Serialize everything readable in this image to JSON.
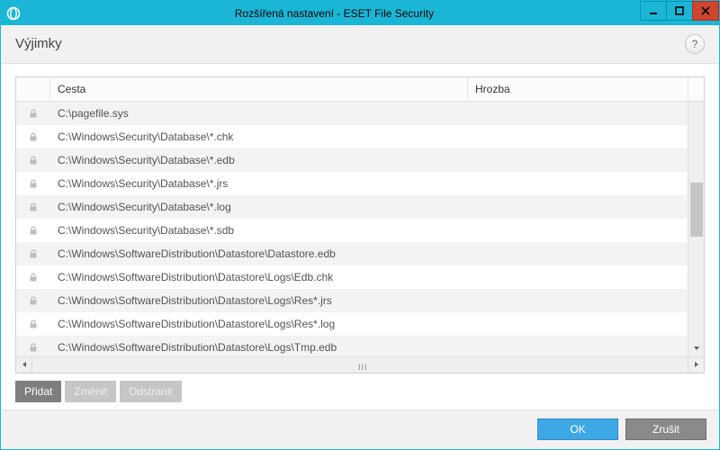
{
  "window": {
    "title": "Rozšířená nastavení - ESET File Security"
  },
  "header": {
    "title": "Výjimky",
    "help_tooltip": "?"
  },
  "columns": {
    "path": "Cesta",
    "threat": "Hrozba"
  },
  "rows": [
    {
      "path": "C:\\pagefile.sys",
      "threat": ""
    },
    {
      "path": "C:\\Windows\\Security\\Database\\*.chk",
      "threat": ""
    },
    {
      "path": "C:\\Windows\\Security\\Database\\*.edb",
      "threat": ""
    },
    {
      "path": "C:\\Windows\\Security\\Database\\*.jrs",
      "threat": ""
    },
    {
      "path": "C:\\Windows\\Security\\Database\\*.log",
      "threat": ""
    },
    {
      "path": "C:\\Windows\\Security\\Database\\*.sdb",
      "threat": ""
    },
    {
      "path": "C:\\Windows\\SoftwareDistribution\\Datastore\\Datastore.edb",
      "threat": ""
    },
    {
      "path": "C:\\Windows\\SoftwareDistribution\\Datastore\\Logs\\Edb.chk",
      "threat": ""
    },
    {
      "path": "C:\\Windows\\SoftwareDistribution\\Datastore\\Logs\\Res*.jrs",
      "threat": ""
    },
    {
      "path": "C:\\Windows\\SoftwareDistribution\\Datastore\\Logs\\Res*.log",
      "threat": ""
    },
    {
      "path": "C:\\Windows\\SoftwareDistribution\\Datastore\\Logs\\Tmp.edb",
      "threat": ""
    }
  ],
  "buttons": {
    "add": "Přidat",
    "edit": "Změnit",
    "delete": "Odstranit",
    "ok": "OK",
    "cancel": "Zrušit"
  },
  "colors": {
    "accent": "#1bb6d6",
    "ok_button": "#3ea8e6"
  }
}
